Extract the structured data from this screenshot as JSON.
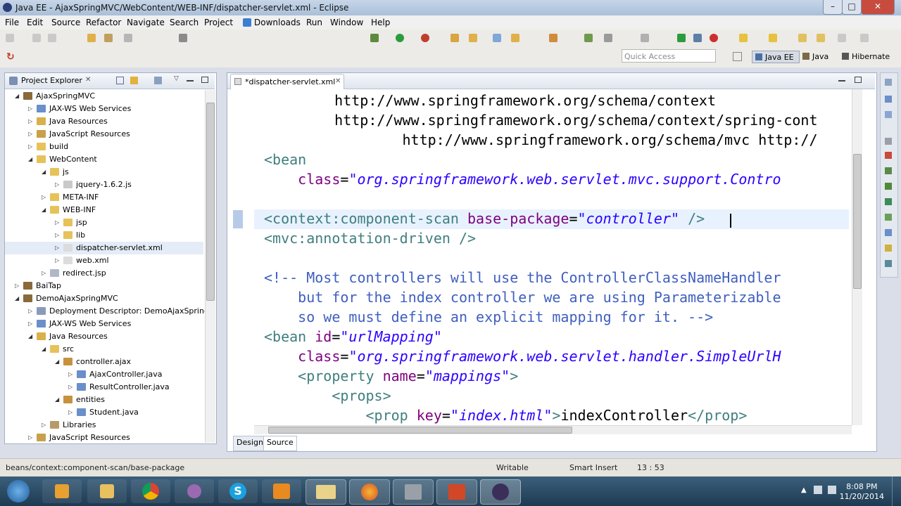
{
  "window": {
    "title": "Java EE - AjaxSpringMVC/WebContent/WEB-INF/dispatcher-servlet.xml - Eclipse",
    "minimize": "–",
    "maximize": "□",
    "close": "✕"
  },
  "menu": [
    "File",
    "Edit",
    "Source",
    "Refactor",
    "Navigate",
    "Search",
    "Project",
    "Downloads",
    "Run",
    "Window",
    "Help"
  ],
  "quick_access": {
    "placeholder": "Quick Access"
  },
  "perspectives": [
    "Java EE",
    "Java",
    "Hibernate"
  ],
  "explorer": {
    "title": "Project Explorer",
    "tree": [
      {
        "label": "AjaxSpringMVC",
        "icon": "project-icon",
        "expanded": true
      },
      {
        "label": "JAX-WS Web Services",
        "icon": "webservice-icon",
        "expanded": false
      },
      {
        "label": "Java Resources",
        "icon": "java-resources-icon",
        "expanded": false
      },
      {
        "label": "JavaScript Resources",
        "icon": "js-resources-icon",
        "expanded": false
      },
      {
        "label": "build",
        "icon": "folder-icon",
        "expanded": false
      },
      {
        "label": "WebContent",
        "icon": "folder-icon",
        "expanded": true
      },
      {
        "label": "js",
        "icon": "folder-icon",
        "expanded": true
      },
      {
        "label": "jquery-1.6.2.js",
        "icon": "js-file-icon",
        "expanded": false
      },
      {
        "label": "META-INF",
        "icon": "folder-icon",
        "expanded": false
      },
      {
        "label": "WEB-INF",
        "icon": "folder-icon",
        "expanded": true
      },
      {
        "label": "jsp",
        "icon": "folder-icon",
        "expanded": false
      },
      {
        "label": "lib",
        "icon": "folder-icon",
        "expanded": false
      },
      {
        "label": "dispatcher-servlet.xml",
        "icon": "xml-file-icon",
        "expanded": false
      },
      {
        "label": "web.xml",
        "icon": "xml-file-icon",
        "expanded": false
      },
      {
        "label": "redirect.jsp",
        "icon": "jsp-file-icon",
        "expanded": false
      },
      {
        "label": "BaiTap",
        "icon": "project-icon",
        "expanded": false
      },
      {
        "label": "DemoAjaxSpringMVC",
        "icon": "project-icon",
        "expanded": true
      },
      {
        "label": "Deployment Descriptor: DemoAjaxSpring",
        "icon": "descriptor-icon",
        "expanded": false
      },
      {
        "label": "JAX-WS Web Services",
        "icon": "webservice-icon",
        "expanded": false
      },
      {
        "label": "Java Resources",
        "icon": "java-resources-icon",
        "expanded": true
      },
      {
        "label": "src",
        "icon": "source-folder-icon",
        "expanded": true
      },
      {
        "label": "controller.ajax",
        "icon": "package-icon",
        "expanded": true
      },
      {
        "label": "AjaxController.java",
        "icon": "java-file-icon",
        "expanded": false
      },
      {
        "label": "ResultController.java",
        "icon": "java-file-icon",
        "expanded": false
      },
      {
        "label": "entities",
        "icon": "package-icon",
        "expanded": true
      },
      {
        "label": "Student.java",
        "icon": "java-file-icon",
        "expanded": false
      },
      {
        "label": "Libraries",
        "icon": "library-icon",
        "expanded": false
      },
      {
        "label": "JavaScript Resources",
        "icon": "js-resources-icon",
        "expanded": false
      }
    ]
  },
  "editor": {
    "tab_label": "*dispatcher-servlet.xml",
    "bottom_tabs": [
      "Design",
      "Source"
    ],
    "code": [
      [
        {
          "t": "txt",
          "s": "    http://www.springframework.org/schema/context"
        }
      ],
      [
        {
          "t": "txt",
          "s": "    http://www.springframework.org/schema/context/spring-cont"
        }
      ],
      [
        {
          "t": "txt",
          "s": "            http://www.springframework.org/schema/mvc http://"
        }
      ],
      [
        {
          "t": "tag",
          "s": "<bean"
        }
      ],
      [
        {
          "t": "txt",
          "s": "    "
        },
        {
          "t": "attr",
          "s": "class"
        },
        {
          "t": "txt",
          "s": "="
        },
        {
          "t": "val",
          "s": "\"org.springframework.web.servlet.mvc.support.Contro"
        }
      ],
      [
        {
          "t": "txt",
          "s": ""
        }
      ],
      [
        {
          "t": "tag",
          "s": "<context:component-scan "
        },
        {
          "t": "attr",
          "s": "base-package"
        },
        {
          "t": "txt",
          "s": "="
        },
        {
          "t": "val",
          "s": "\"controller\""
        },
        {
          "t": "tag",
          "s": " />"
        }
      ],
      [
        {
          "t": "tag",
          "s": "<mvc:annotation-driven />"
        }
      ],
      [
        {
          "t": "txt",
          "s": ""
        }
      ],
      [
        {
          "t": "cmt",
          "s": "<!-- Most controllers will use the ControllerClassNameHandler"
        }
      ],
      [
        {
          "t": "cmt",
          "s": "    but for the index controller we are using Parameterizable"
        }
      ],
      [
        {
          "t": "cmt",
          "s": "    so we must define an explicit mapping for it. -->"
        }
      ],
      [
        {
          "t": "tag",
          "s": "<bean "
        },
        {
          "t": "attr",
          "s": "id"
        },
        {
          "t": "txt",
          "s": "="
        },
        {
          "t": "val",
          "s": "\"urlMapping\""
        }
      ],
      [
        {
          "t": "txt",
          "s": "    "
        },
        {
          "t": "attr",
          "s": "class"
        },
        {
          "t": "txt",
          "s": "="
        },
        {
          "t": "val",
          "s": "\"org.springframework.web.servlet.handler.SimpleUrlH"
        }
      ],
      [
        {
          "t": "txt",
          "s": "    "
        },
        {
          "t": "tag",
          "s": "<property "
        },
        {
          "t": "attr",
          "s": "name"
        },
        {
          "t": "txt",
          "s": "="
        },
        {
          "t": "val",
          "s": "\"mappings\""
        },
        {
          "t": "tag",
          "s": ">"
        }
      ],
      [
        {
          "t": "txt",
          "s": "        "
        },
        {
          "t": "tag",
          "s": "<props>"
        }
      ],
      [
        {
          "t": "txt",
          "s": "            "
        },
        {
          "t": "tag",
          "s": "<prop "
        },
        {
          "t": "attr",
          "s": "key"
        },
        {
          "t": "txt",
          "s": "="
        },
        {
          "t": "val",
          "s": "\"index.html\""
        },
        {
          "t": "tag",
          "s": ">"
        },
        {
          "t": "txt",
          "s": "indexController"
        },
        {
          "t": "tag",
          "s": "</prop>"
        }
      ]
    ]
  },
  "status": {
    "path": "beans/context:component-scan/base-package",
    "mode": "Writable",
    "insert": "Smart Insert",
    "position": "13 : 53"
  },
  "clock": {
    "time": "8:08 PM",
    "date": "11/20/2014"
  },
  "colors": {
    "accent": "#3f7f7f",
    "attribute": "#7f007f",
    "string": "#2a00ff",
    "comment": "#3f5fbf"
  }
}
